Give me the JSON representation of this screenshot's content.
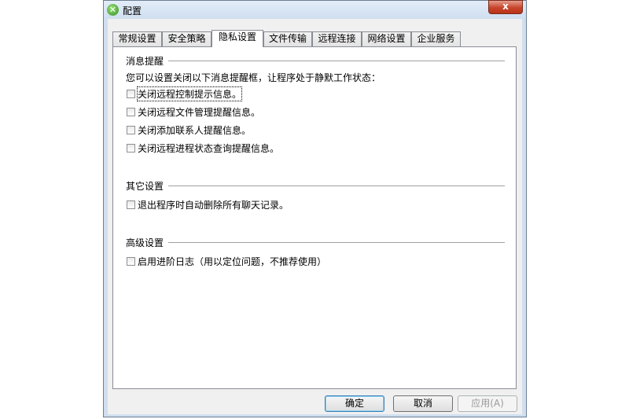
{
  "window": {
    "title": "配置",
    "app_icon": "x-logo-icon",
    "close_glyph": "x"
  },
  "tabs": [
    {
      "label": "常规设置",
      "active": false
    },
    {
      "label": "安全策略",
      "active": false
    },
    {
      "label": "隐私设置",
      "active": true
    },
    {
      "label": "文件传输",
      "active": false
    },
    {
      "label": "远程连接",
      "active": false
    },
    {
      "label": "网络设置",
      "active": false
    },
    {
      "label": "企业服务",
      "active": false
    }
  ],
  "sections": {
    "messages": {
      "title": "消息提醒",
      "description": "您可以设置关闭以下消息提醒框，让程序处于静默工作状态：",
      "options": [
        {
          "label": "关闭远程控制提示信息。",
          "checked": false
        },
        {
          "label": "关闭远程文件管理提醒信息。",
          "checked": false
        },
        {
          "label": "关闭添加联系人提醒信息。",
          "checked": false
        },
        {
          "label": "关闭远程进程状态查询提醒信息。",
          "checked": false
        }
      ]
    },
    "other": {
      "title": "其它设置",
      "options": [
        {
          "label": "退出程序时自动删除所有聊天记录。",
          "checked": false
        }
      ]
    },
    "advanced": {
      "title": "高级设置",
      "options": [
        {
          "label": "启用进阶日志（用以定位问题，不推荐使用）",
          "checked": false
        }
      ]
    }
  },
  "buttons": {
    "ok": "确定",
    "cancel": "取消",
    "apply": "应用(A)"
  }
}
